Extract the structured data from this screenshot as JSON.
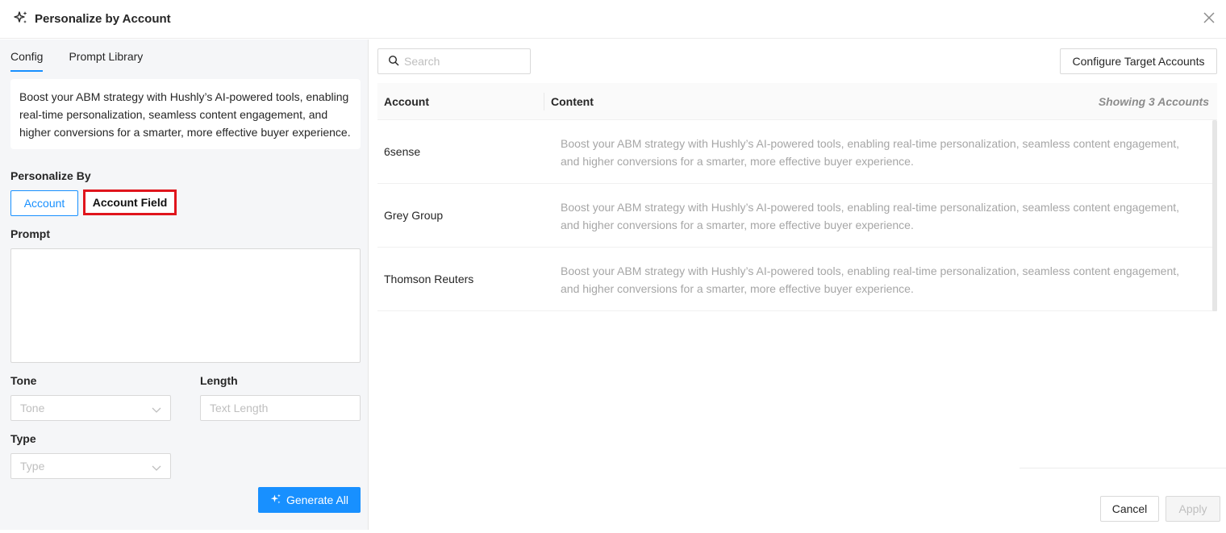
{
  "header": {
    "title": "Personalize by Account",
    "icon": "sparkles-icon"
  },
  "left": {
    "tabs": [
      {
        "label": "Config",
        "active": true
      },
      {
        "label": "Prompt Library",
        "active": false
      }
    ],
    "description": "Boost your ABM strategy with Hushly’s AI-powered tools, enabling real-time personalization, seamless content engagement, and higher conversions for a smarter, more effective buyer experience.",
    "personalize_by": {
      "label": "Personalize By",
      "options": [
        "Account",
        "Account Field"
      ],
      "selected": "Account"
    },
    "prompt": {
      "label": "Prompt",
      "value": ""
    },
    "tone": {
      "label": "Tone",
      "placeholder": "Tone"
    },
    "length": {
      "label": "Length",
      "placeholder": "Text Length"
    },
    "type": {
      "label": "Type",
      "placeholder": "Type"
    },
    "generate_label": "Generate All"
  },
  "right": {
    "search": {
      "placeholder": "Search"
    },
    "configure_label": "Configure Target Accounts",
    "table": {
      "columns": [
        "Account",
        "Content"
      ],
      "count_label": "Showing 3 Accounts",
      "rows": [
        {
          "account": "6sense",
          "content": "Boost your ABM strategy with Hushly’s AI-powered tools, enabling real-time personalization, seamless content engagement, and higher conversions for a smarter, more effective buyer experience."
        },
        {
          "account": "Grey Group",
          "content": "Boost your ABM strategy with Hushly’s AI-powered tools, enabling real-time personalization, seamless content engagement, and higher conversions for a smarter, more effective buyer experience."
        },
        {
          "account": "Thomson Reuters",
          "content": "Boost your ABM strategy with Hushly’s AI-powered tools, enabling real-time personalization, seamless content engagement, and higher conversions for a smarter, more effective buyer experience."
        }
      ]
    },
    "footer": {
      "cancel_label": "Cancel",
      "apply_label": "Apply"
    }
  },
  "colors": {
    "accent": "#1890ff",
    "highlight": "#e0151c"
  }
}
